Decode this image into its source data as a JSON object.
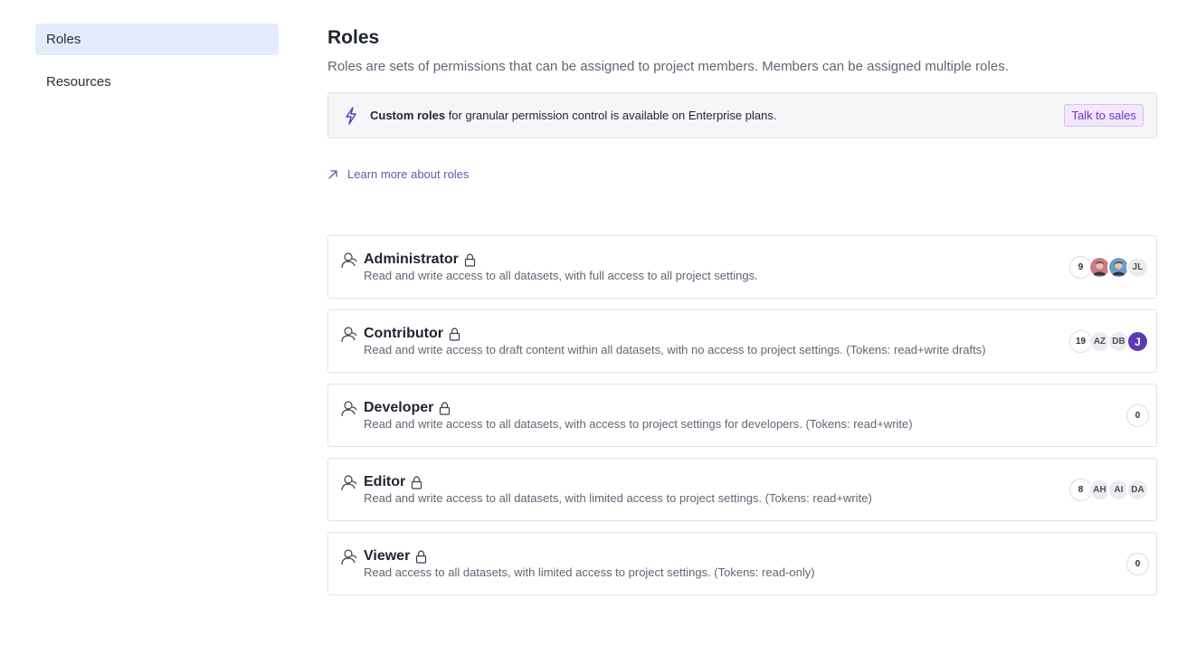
{
  "sidebar": {
    "items": [
      {
        "label": "Roles",
        "active": true
      },
      {
        "label": "Resources",
        "active": false
      }
    ]
  },
  "header": {
    "title": "Roles",
    "subtitle": "Roles are sets of permissions that can be assigned to project members. Members can be assigned multiple roles."
  },
  "banner": {
    "icon": "lightning-icon",
    "bold": "Custom roles",
    "text": " for granular permission control is available on Enterprise plans.",
    "button": "Talk to sales"
  },
  "learn_link": {
    "icon": "arrow-up-right-icon",
    "label": "Learn more about roles"
  },
  "roles": [
    {
      "name": "Administrator",
      "description": "Read and write access to all datasets, with full access to all project settings.",
      "count": "9",
      "members": [
        {
          "type": "photo",
          "initials": "",
          "color": "#c97a8a"
        },
        {
          "type": "photo",
          "initials": "",
          "color": "#6a9cc9"
        },
        {
          "type": "initials",
          "initials": "JL",
          "color": "#ececef"
        }
      ]
    },
    {
      "name": "Contributor",
      "description": "Read and write access to draft content within all datasets, with no access to project settings. (Tokens: read+write drafts)",
      "count": "19",
      "members": [
        {
          "type": "initials",
          "initials": "AZ",
          "color": "#ececef"
        },
        {
          "type": "initials",
          "initials": "DB",
          "color": "#ececef"
        },
        {
          "type": "initials",
          "initials": "J",
          "color": "#5b3ab8"
        }
      ]
    },
    {
      "name": "Developer",
      "description": "Read and write access to all datasets, with access to project settings for developers. (Tokens: read+write)",
      "count": "0",
      "members": []
    },
    {
      "name": "Editor",
      "description": "Read and write access to all datasets, with limited access to project settings. (Tokens: read+write)",
      "count": "8",
      "members": [
        {
          "type": "initials",
          "initials": "AH",
          "color": "#ececef"
        },
        {
          "type": "initials",
          "initials": "AI",
          "color": "#ececef"
        },
        {
          "type": "initials",
          "initials": "DA",
          "color": "#ececef"
        }
      ]
    },
    {
      "name": "Viewer",
      "description": "Read access to all datasets, with limited access to project settings. (Tokens: read-only)",
      "count": "0",
      "members": []
    }
  ],
  "colors": {
    "accent": "#6b35c9",
    "sidebar_active": "#e3ebfc",
    "link": "#5a5fa8"
  }
}
